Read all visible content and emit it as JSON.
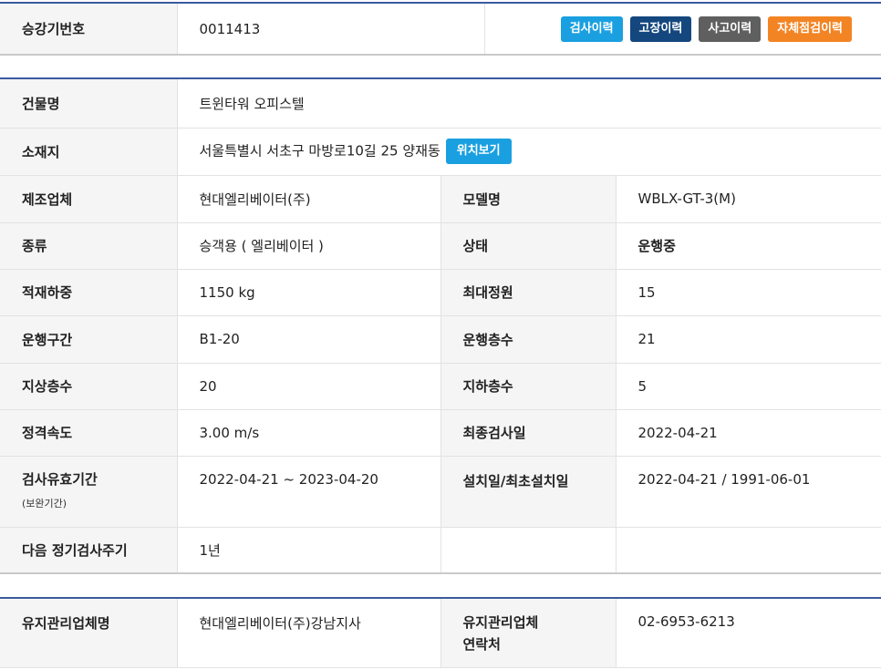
{
  "header": {
    "elevator_no_label": "승강기번호",
    "elevator_no_value": "0011413",
    "buttons": {
      "inspection_history": "검사이력",
      "fault_history": "고장이력",
      "accident_history": "사고이력",
      "self_check_history": "자체점검이력"
    }
  },
  "building": {
    "name_label": "건물명",
    "name_value": "트윈타워 오피스텔",
    "address_label": "소재지",
    "address_value": "서울특별시 서초구 마방로10길 25 양재동",
    "location_button": "위치보기"
  },
  "specs": {
    "manufacturer_label": "제조업체",
    "manufacturer_value": "현대엘리베이터(주)",
    "model_label": "모델명",
    "model_value": "WBLX-GT-3(M)",
    "type_label": "종류",
    "type_value": "승객용 ( 엘리베이터 )",
    "status_label": "상태",
    "status_value": "운행중",
    "load_label": "적재하중",
    "load_value": "1150 kg",
    "capacity_label": "최대정원",
    "capacity_value": "15",
    "section_label": "운행구간",
    "section_value": "B1-20",
    "floors_label": "운행층수",
    "floors_value": "21",
    "above_label": "지상층수",
    "above_value": "20",
    "below_label": "지하층수",
    "below_value": "5",
    "speed_label": "정격속도",
    "speed_value": "3.00 m/s",
    "last_insp_label": "최종검사일",
    "last_insp_value": "2022-04-21",
    "validity_label": "검사유효기간",
    "validity_sub": "(보완기간)",
    "validity_value": "2022-04-21 ~ 2023-04-20",
    "install_label": "설치일/최초설치일",
    "install_value": "2022-04-21 / 1991-06-01",
    "next_cycle_label": "다음 정기검사주기",
    "next_cycle_value": "1년"
  },
  "maintenance": {
    "company_label": "유지관리업체명",
    "company_value": "현대엘리베이터(주)강남지사",
    "contact_label_line1": "유지관리업체",
    "contact_label_line2": "연락처",
    "contact_value": "02-6953-6213"
  },
  "colors": {
    "accent_line": "#3b5a9e",
    "label_bg": "#f5f5f5",
    "inspection_btn": "#1aa0e0",
    "fault_btn": "#14477e",
    "accident_btn": "#5f5f5f",
    "self_check_btn": "#f38424"
  }
}
